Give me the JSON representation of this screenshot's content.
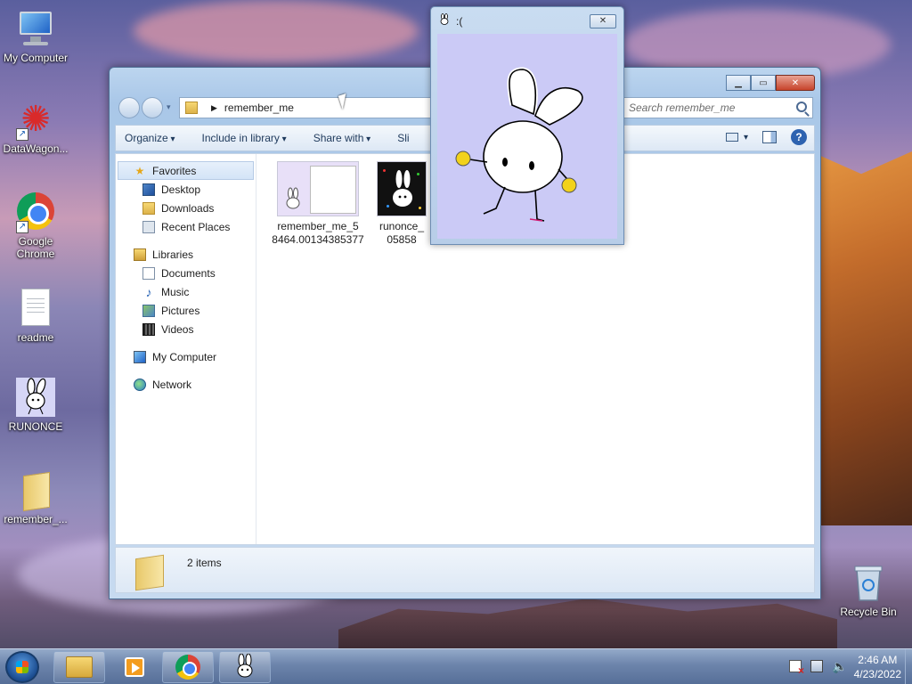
{
  "desktop": {
    "icons": [
      {
        "label": "My Computer"
      },
      {
        "label": "DataWagon..."
      },
      {
        "label": "Google Chrome"
      },
      {
        "label": "readme"
      },
      {
        "label": "RUNONCE"
      },
      {
        "label": "remember_..."
      },
      {
        "label": "Recycle Bin"
      }
    ]
  },
  "explorer": {
    "address": "remember_me",
    "search_placeholder": "Search remember_me",
    "toolbar": {
      "organize": "Organize",
      "include_in_library": "Include in library",
      "share_with": "Share with",
      "slideshow_partial": "Sli"
    },
    "nav": {
      "favorites": "Favorites",
      "desktop": "Desktop",
      "downloads": "Downloads",
      "recent_places": "Recent Places",
      "libraries": "Libraries",
      "documents": "Documents",
      "music": "Music",
      "pictures": "Pictures",
      "videos": "Videos",
      "my_computer": "My Computer",
      "network": "Network"
    },
    "files": [
      {
        "name_line1": "remember_me_5",
        "name_line2": "8464.00134385377"
      },
      {
        "name_line1": "runonce_",
        "name_line2": "05858"
      }
    ],
    "status": "2 items"
  },
  "popup": {
    "title": ":("
  },
  "taskbar": {
    "time": "2:46 AM",
    "date": "4/23/2022"
  },
  "colors": {
    "popup_canvas": "#cbcaf6",
    "explorer_frame": "#a9c7e8",
    "taskbar": "#6c84ab"
  }
}
